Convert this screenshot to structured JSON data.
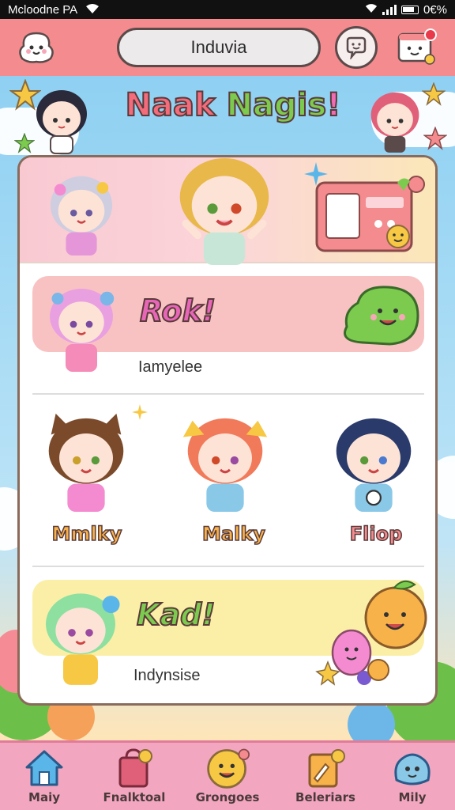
{
  "status_bar": {
    "carrier": "Mcloodne PA",
    "battery": "0€%"
  },
  "header": {
    "search_value": "Induvia"
  },
  "title": {
    "word1": "Naak",
    "word2": "Nagis",
    "word3": "!"
  },
  "sections": {
    "rok": {
      "title": "Rok!",
      "subtitle": "Iamyelee"
    },
    "kad": {
      "title": "Kad!",
      "subtitle": "Indynsise"
    }
  },
  "characters": [
    {
      "name": "Mmlky",
      "color": "#f7b24a"
    },
    {
      "name": "Malky",
      "color": "#f7b24a"
    },
    {
      "name": "Fliop",
      "color": "#f48b8e"
    }
  ],
  "bottom_nav": [
    {
      "label": "Maiy",
      "icon": "home-icon"
    },
    {
      "label": "Fnalktoal",
      "icon": "shop-bag-icon"
    },
    {
      "label": "Grongoes",
      "icon": "smiley-icon"
    },
    {
      "label": "Beleriars",
      "icon": "notepad-icon"
    },
    {
      "label": "Mily",
      "icon": "mascot-icon"
    }
  ],
  "colors": {
    "header": "#f48b8e",
    "sky": "#8fd0f2",
    "nav": "#f3a6c0",
    "accent_pink": "#e866b8",
    "accent_green": "#7ccb4f"
  }
}
